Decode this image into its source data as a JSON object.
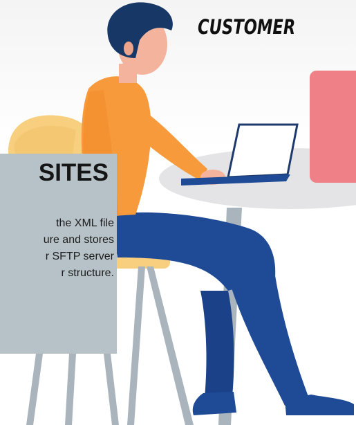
{
  "scene": {
    "label": "CUSTOMER"
  },
  "card": {
    "title": "SITES",
    "lines": [
      "the XML file",
      "ure and stores",
      "r SFTP server",
      "r structure."
    ]
  },
  "colors": {
    "shirt": "#f79a3b",
    "pants": "#1f4b96",
    "hair": "#173766",
    "skin": "#f3b39c",
    "chair": "#f7cf7e",
    "table_top": "#e4e4e6",
    "pink_box": "#ef8087",
    "card": "#b7c2c8",
    "legs": "#a9b4bc"
  },
  "icons": [
    "person-illustration",
    "laptop-icon",
    "chair-illustration",
    "table-illustration"
  ]
}
